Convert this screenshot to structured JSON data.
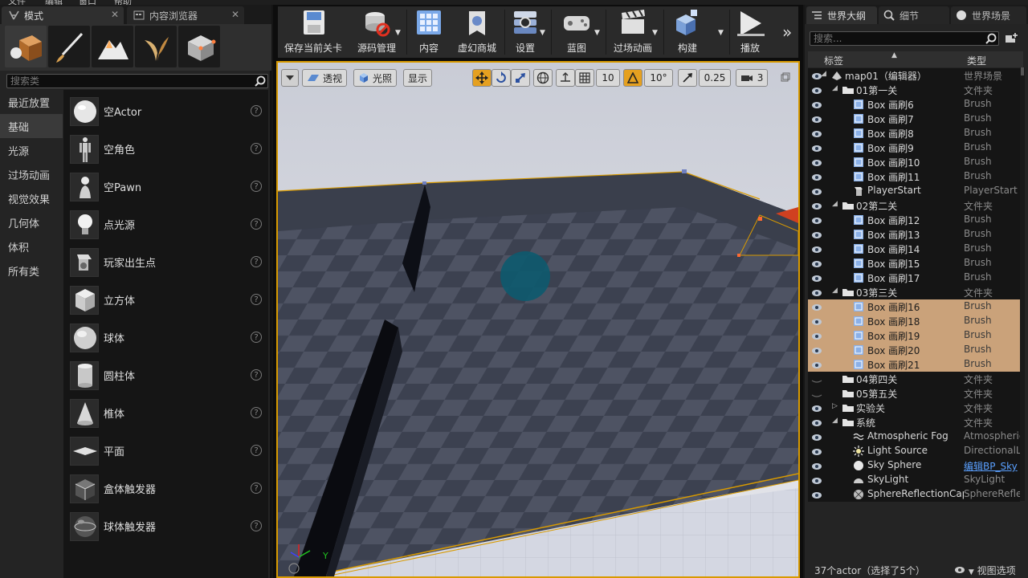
{
  "menubar": [
    "文件",
    "编辑",
    "窗口",
    "帮助"
  ],
  "left": {
    "tabs": [
      {
        "label": "模式",
        "close": "✕"
      },
      {
        "label": "内容浏览器",
        "close": "✕"
      }
    ],
    "search_placeholder": "搜索类",
    "categories": [
      "最近放置",
      "基础",
      "光源",
      "过场动画",
      "视觉效果",
      "几何体",
      "体积",
      "所有类"
    ],
    "selected_category": "基础",
    "items": [
      {
        "label": "空Actor",
        "icon": "sphere-white-icon"
      },
      {
        "label": "空角色",
        "icon": "mannequin-icon"
      },
      {
        "label": "空Pawn",
        "icon": "pawn-icon"
      },
      {
        "label": "点光源",
        "icon": "light-bulb-icon"
      },
      {
        "label": "玩家出生点",
        "icon": "player-start-icon"
      },
      {
        "label": "立方体",
        "icon": "cube-icon"
      },
      {
        "label": "球体",
        "icon": "sphere-icon"
      },
      {
        "label": "圆柱体",
        "icon": "cylinder-icon"
      },
      {
        "label": "椎体",
        "icon": "cone-icon"
      },
      {
        "label": "平面",
        "icon": "plane-icon"
      },
      {
        "label": "盒体触发器",
        "icon": "box-trigger-icon"
      },
      {
        "label": "球体触发器",
        "icon": "sphere-trigger-icon"
      }
    ],
    "help_glyph": "?"
  },
  "toolbar": {
    "buttons": [
      {
        "label": "保存当前关卡",
        "icon": "save-icon"
      },
      {
        "label": "源码管理",
        "icon": "source-control-icon"
      },
      {
        "label": "内容",
        "icon": "content-icon"
      },
      {
        "label": "虚幻商城",
        "icon": "marketplace-icon"
      },
      {
        "label": "设置",
        "icon": "settings-icon"
      },
      {
        "label": "蓝图",
        "icon": "blueprint-icon"
      },
      {
        "label": "过场动画",
        "icon": "cinematics-icon"
      },
      {
        "label": "构建",
        "icon": "build-icon"
      },
      {
        "label": "播放",
        "icon": "play-icon"
      }
    ],
    "more": "»"
  },
  "viewport": {
    "perspective_label": "透视",
    "lit_label": "光照",
    "show_label": "显示",
    "grid_snap": "10",
    "rotate_snap": "10°",
    "scale_snap": "0.25",
    "camera_speed": "3",
    "axis_y": "Y"
  },
  "right": {
    "tabs": [
      {
        "label": "世界大纲"
      },
      {
        "label": "细节"
      },
      {
        "label": "世界场景"
      }
    ],
    "search_placeholder": "搜索...",
    "col_label": "标签",
    "col_type": "类型",
    "rows": [
      {
        "name": "map01（编辑器）",
        "type": "世界场景",
        "depth": 0,
        "kind": "world",
        "expanded": true,
        "sel": false
      },
      {
        "name": "01第一关",
        "type": "文件夹",
        "depth": 1,
        "kind": "folder",
        "expanded": true,
        "sel": false
      },
      {
        "name": "Box 画刷6",
        "type": "Brush",
        "depth": 2,
        "kind": "brush",
        "sel": false
      },
      {
        "name": "Box 画刷7",
        "type": "Brush",
        "depth": 2,
        "kind": "brush",
        "sel": false
      },
      {
        "name": "Box 画刷8",
        "type": "Brush",
        "depth": 2,
        "kind": "brush",
        "sel": false
      },
      {
        "name": "Box 画刷9",
        "type": "Brush",
        "depth": 2,
        "kind": "brush",
        "sel": false
      },
      {
        "name": "Box 画刷10",
        "type": "Brush",
        "depth": 2,
        "kind": "brush",
        "sel": false
      },
      {
        "name": "Box 画刷11",
        "type": "Brush",
        "depth": 2,
        "kind": "brush",
        "sel": false
      },
      {
        "name": "PlayerStart",
        "type": "PlayerStart",
        "depth": 2,
        "kind": "player",
        "sel": false
      },
      {
        "name": "02第二关",
        "type": "文件夹",
        "depth": 1,
        "kind": "folder",
        "expanded": true,
        "sel": false
      },
      {
        "name": "Box 画刷12",
        "type": "Brush",
        "depth": 2,
        "kind": "brush",
        "sel": false
      },
      {
        "name": "Box 画刷13",
        "type": "Brush",
        "depth": 2,
        "kind": "brush",
        "sel": false
      },
      {
        "name": "Box 画刷14",
        "type": "Brush",
        "depth": 2,
        "kind": "brush",
        "sel": false
      },
      {
        "name": "Box 画刷15",
        "type": "Brush",
        "depth": 2,
        "kind": "brush",
        "sel": false
      },
      {
        "name": "Box 画刷17",
        "type": "Brush",
        "depth": 2,
        "kind": "brush",
        "sel": false
      },
      {
        "name": "03第三关",
        "type": "文件夹",
        "depth": 1,
        "kind": "folder",
        "expanded": true,
        "sel": false
      },
      {
        "name": "Box 画刷16",
        "type": "Brush",
        "depth": 2,
        "kind": "brush",
        "sel": true
      },
      {
        "name": "Box 画刷18",
        "type": "Brush",
        "depth": 2,
        "kind": "brush",
        "sel": true
      },
      {
        "name": "Box 画刷19",
        "type": "Brush",
        "depth": 2,
        "kind": "brush",
        "sel": true
      },
      {
        "name": "Box 画刷20",
        "type": "Brush",
        "depth": 2,
        "kind": "brush",
        "sel": true
      },
      {
        "name": "Box 画刷21",
        "type": "Brush",
        "depth": 2,
        "kind": "brush",
        "sel": true
      },
      {
        "name": "04第四关",
        "type": "文件夹",
        "depth": 1,
        "kind": "folder",
        "expanded": false,
        "sel": false,
        "hidden": true
      },
      {
        "name": "05第五关",
        "type": "文件夹",
        "depth": 1,
        "kind": "folder",
        "expanded": false,
        "sel": false,
        "hidden": true
      },
      {
        "name": "实验关",
        "type": "文件夹",
        "depth": 1,
        "kind": "folder",
        "expanded": false,
        "collapsed_arrow": true,
        "sel": false
      },
      {
        "name": "系统",
        "type": "文件夹",
        "depth": 1,
        "kind": "folder",
        "expanded": true,
        "sel": false
      },
      {
        "name": "Atmospheric Fog",
        "type": "AtmosphericFog",
        "depth": 2,
        "kind": "fog",
        "sel": false
      },
      {
        "name": "Light Source",
        "type": "DirectionalLight",
        "depth": 2,
        "kind": "light",
        "sel": false
      },
      {
        "name": "Sky Sphere",
        "type": "编辑BP_Sky",
        "depth": 2,
        "kind": "skysphere",
        "sel": false,
        "link": true
      },
      {
        "name": "SkyLight",
        "type": "SkyLight",
        "depth": 2,
        "kind": "skylight",
        "sel": false
      },
      {
        "name": "SphereReflectionCapture",
        "type": "SphereReflectionCapture",
        "depth": 2,
        "kind": "reflection",
        "sel": false
      }
    ],
    "status_count": "37个actor（选择了5个）",
    "view_options": "视图选项"
  },
  "colors": {
    "accent": "#d89a00",
    "selection_row": "#caa27a",
    "link": "#5aa0ff"
  }
}
